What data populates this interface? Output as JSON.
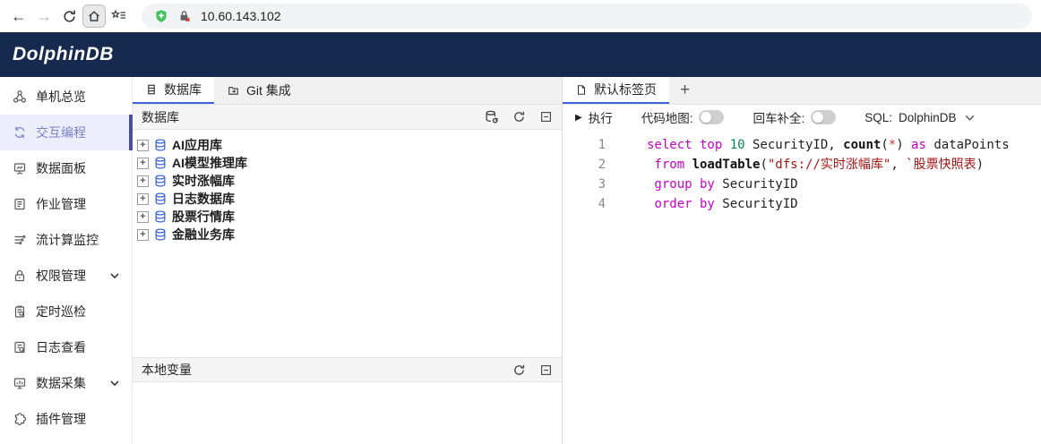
{
  "browser": {
    "url": "10.60.143.102"
  },
  "header": {
    "logo_text": "DolphinDB"
  },
  "icons": {
    "back_glyph": "←",
    "forward_glyph": "→",
    "expand_glyph": "+",
    "play_glyph": "▶",
    "new_tab_glyph": "+"
  },
  "sidebar": {
    "items": [
      {
        "label": "单机总览",
        "active": false,
        "chevron": false
      },
      {
        "label": "交互编程",
        "active": true,
        "chevron": false
      },
      {
        "label": "数据面板",
        "active": false,
        "chevron": false
      },
      {
        "label": "作业管理",
        "active": false,
        "chevron": false
      },
      {
        "label": "流计算监控",
        "active": false,
        "chevron": false
      },
      {
        "label": "权限管理",
        "active": false,
        "chevron": true
      },
      {
        "label": "定时巡检",
        "active": false,
        "chevron": false
      },
      {
        "label": "日志查看",
        "active": false,
        "chevron": false
      },
      {
        "label": "数据采集",
        "active": false,
        "chevron": true
      },
      {
        "label": "插件管理",
        "active": false,
        "chevron": false
      }
    ]
  },
  "middle": {
    "tabs": [
      {
        "label": "数据库"
      },
      {
        "label": "Git 集成"
      }
    ],
    "database_panel_title": "数据库",
    "tree": [
      "AI应用库",
      "AI模型推理库",
      "实时涨幅库",
      "日志数据库",
      "股票行情库",
      "金融业务库"
    ],
    "variables_panel_title": "本地变量"
  },
  "editor": {
    "tab_label": "默认标签页",
    "run_label": "执行",
    "code_map_label": "代码地图:",
    "enter_complete_label": "回车补全:",
    "sql_label": "SQL:",
    "sql_value": "DolphinDB",
    "lines": [
      {
        "no": "1",
        "tokens": [
          {
            "t": "select top ",
            "c": "kw"
          },
          {
            "t": "10",
            "c": "num"
          },
          {
            "t": " SecurityID, ",
            "c": "pl"
          },
          {
            "t": "count",
            "c": "fn"
          },
          {
            "t": "(",
            "c": "pl"
          },
          {
            "t": "*",
            "c": "st2"
          },
          {
            "t": ") ",
            "c": "pl"
          },
          {
            "t": "as",
            "c": "kw"
          },
          {
            "t": " dataPoints",
            "c": "pl"
          }
        ]
      },
      {
        "no": "2",
        "tokens": [
          {
            "t": " from ",
            "c": "kw"
          },
          {
            "t": "loadTable",
            "c": "fn"
          },
          {
            "t": "(",
            "c": "pl"
          },
          {
            "t": "\"dfs://实时涨幅库\"",
            "c": "str"
          },
          {
            "t": ", ",
            "c": "pl"
          },
          {
            "t": "`股票快照表",
            "c": "str"
          },
          {
            "t": ")",
            "c": "pl"
          }
        ]
      },
      {
        "no": "3",
        "tokens": [
          {
            "t": " group by ",
            "c": "kw"
          },
          {
            "t": "SecurityID",
            "c": "pl"
          }
        ]
      },
      {
        "no": "4",
        "tokens": [
          {
            "t": " order by ",
            "c": "kw"
          },
          {
            "t": "SecurityID",
            "c": "pl"
          }
        ]
      }
    ]
  },
  "colors": {
    "header_bg": "#16294e",
    "tab_accent": "#3e63dd",
    "sidebar_active_bg": "#eceefb",
    "sidebar_active_fg": "#7b84ca",
    "sidebar_active_bar": "#46509e",
    "tree_icon_blue": "#3f66d4",
    "panel_header_bg": "#f5f5f5",
    "url_bar_bg": "#f1f3f4",
    "code_keyword": "#c800c8",
    "code_number": "#098658",
    "code_string": "#a31515",
    "code_asterisk": "#cd3131",
    "shield_green": "#45c15e",
    "lock_x_red": "#d93025"
  }
}
